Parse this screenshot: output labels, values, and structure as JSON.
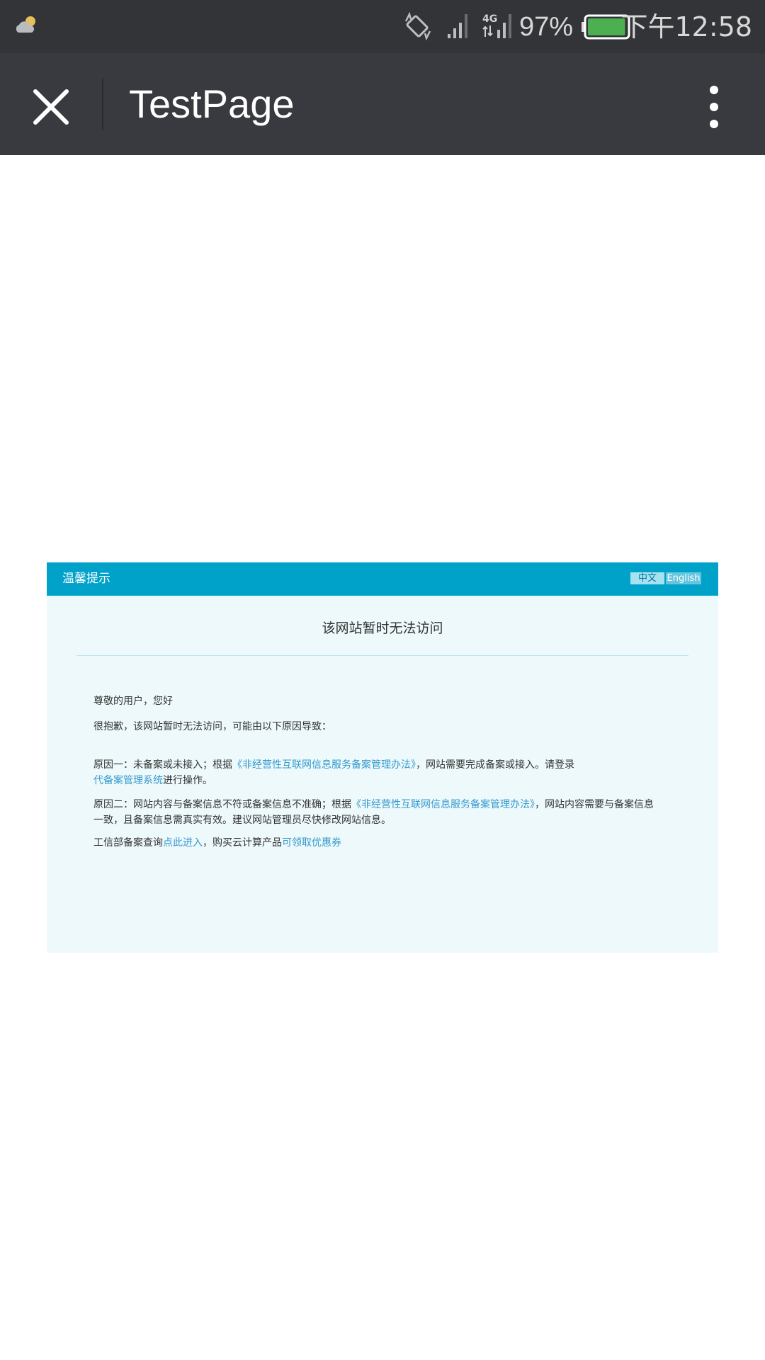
{
  "status_bar": {
    "battery_percent": "97%",
    "time": "下午12:58",
    "network_type": "4G",
    "battery_level": 0.97,
    "battery_color": "#4caf50",
    "icons": [
      "weather-partly-cloudy-icon",
      "screen-rotation-icon",
      "signal-icon",
      "network-4g-icon",
      "battery-icon"
    ]
  },
  "app_bar": {
    "title": "TestPage",
    "icons": [
      "close-icon",
      "more-vertical-icon"
    ]
  },
  "notice": {
    "header_title": "温馨提示",
    "lang_zh": "中文",
    "lang_en": "English",
    "title": "该网站暂时无法访问",
    "greeting": "尊敬的用户，您好",
    "apology": "很抱歉，该网站暂时无法访问，可能由以下原因导致：",
    "reason1": {
      "prefix": "原因一：未备案或未接入；根据",
      "link1": "《非经营性互联网信息服务备案管理办法》",
      "middle": "，网站需要完成备案或接入。请登录",
      "link2": "代备案管理系统",
      "suffix": "进行操作。"
    },
    "reason2": {
      "prefix": "原因二：网站内容与备案信息不符或备案信息不准确；根据",
      "link": "《非经营性互联网信息服务备案管理办法》",
      "suffix": "，网站内容需要与备案信息一致，且备案信息需真实有效。建议网站管理员尽快修改网站信息。"
    },
    "query": {
      "prefix": "工信部备案查询",
      "link1": "点此进入",
      "middle": "，购买云计算产品",
      "link2": "可领取优惠券"
    },
    "colors": {
      "header": "#00a2ca",
      "background": "#eef9fc",
      "link": "#3399cc"
    }
  }
}
